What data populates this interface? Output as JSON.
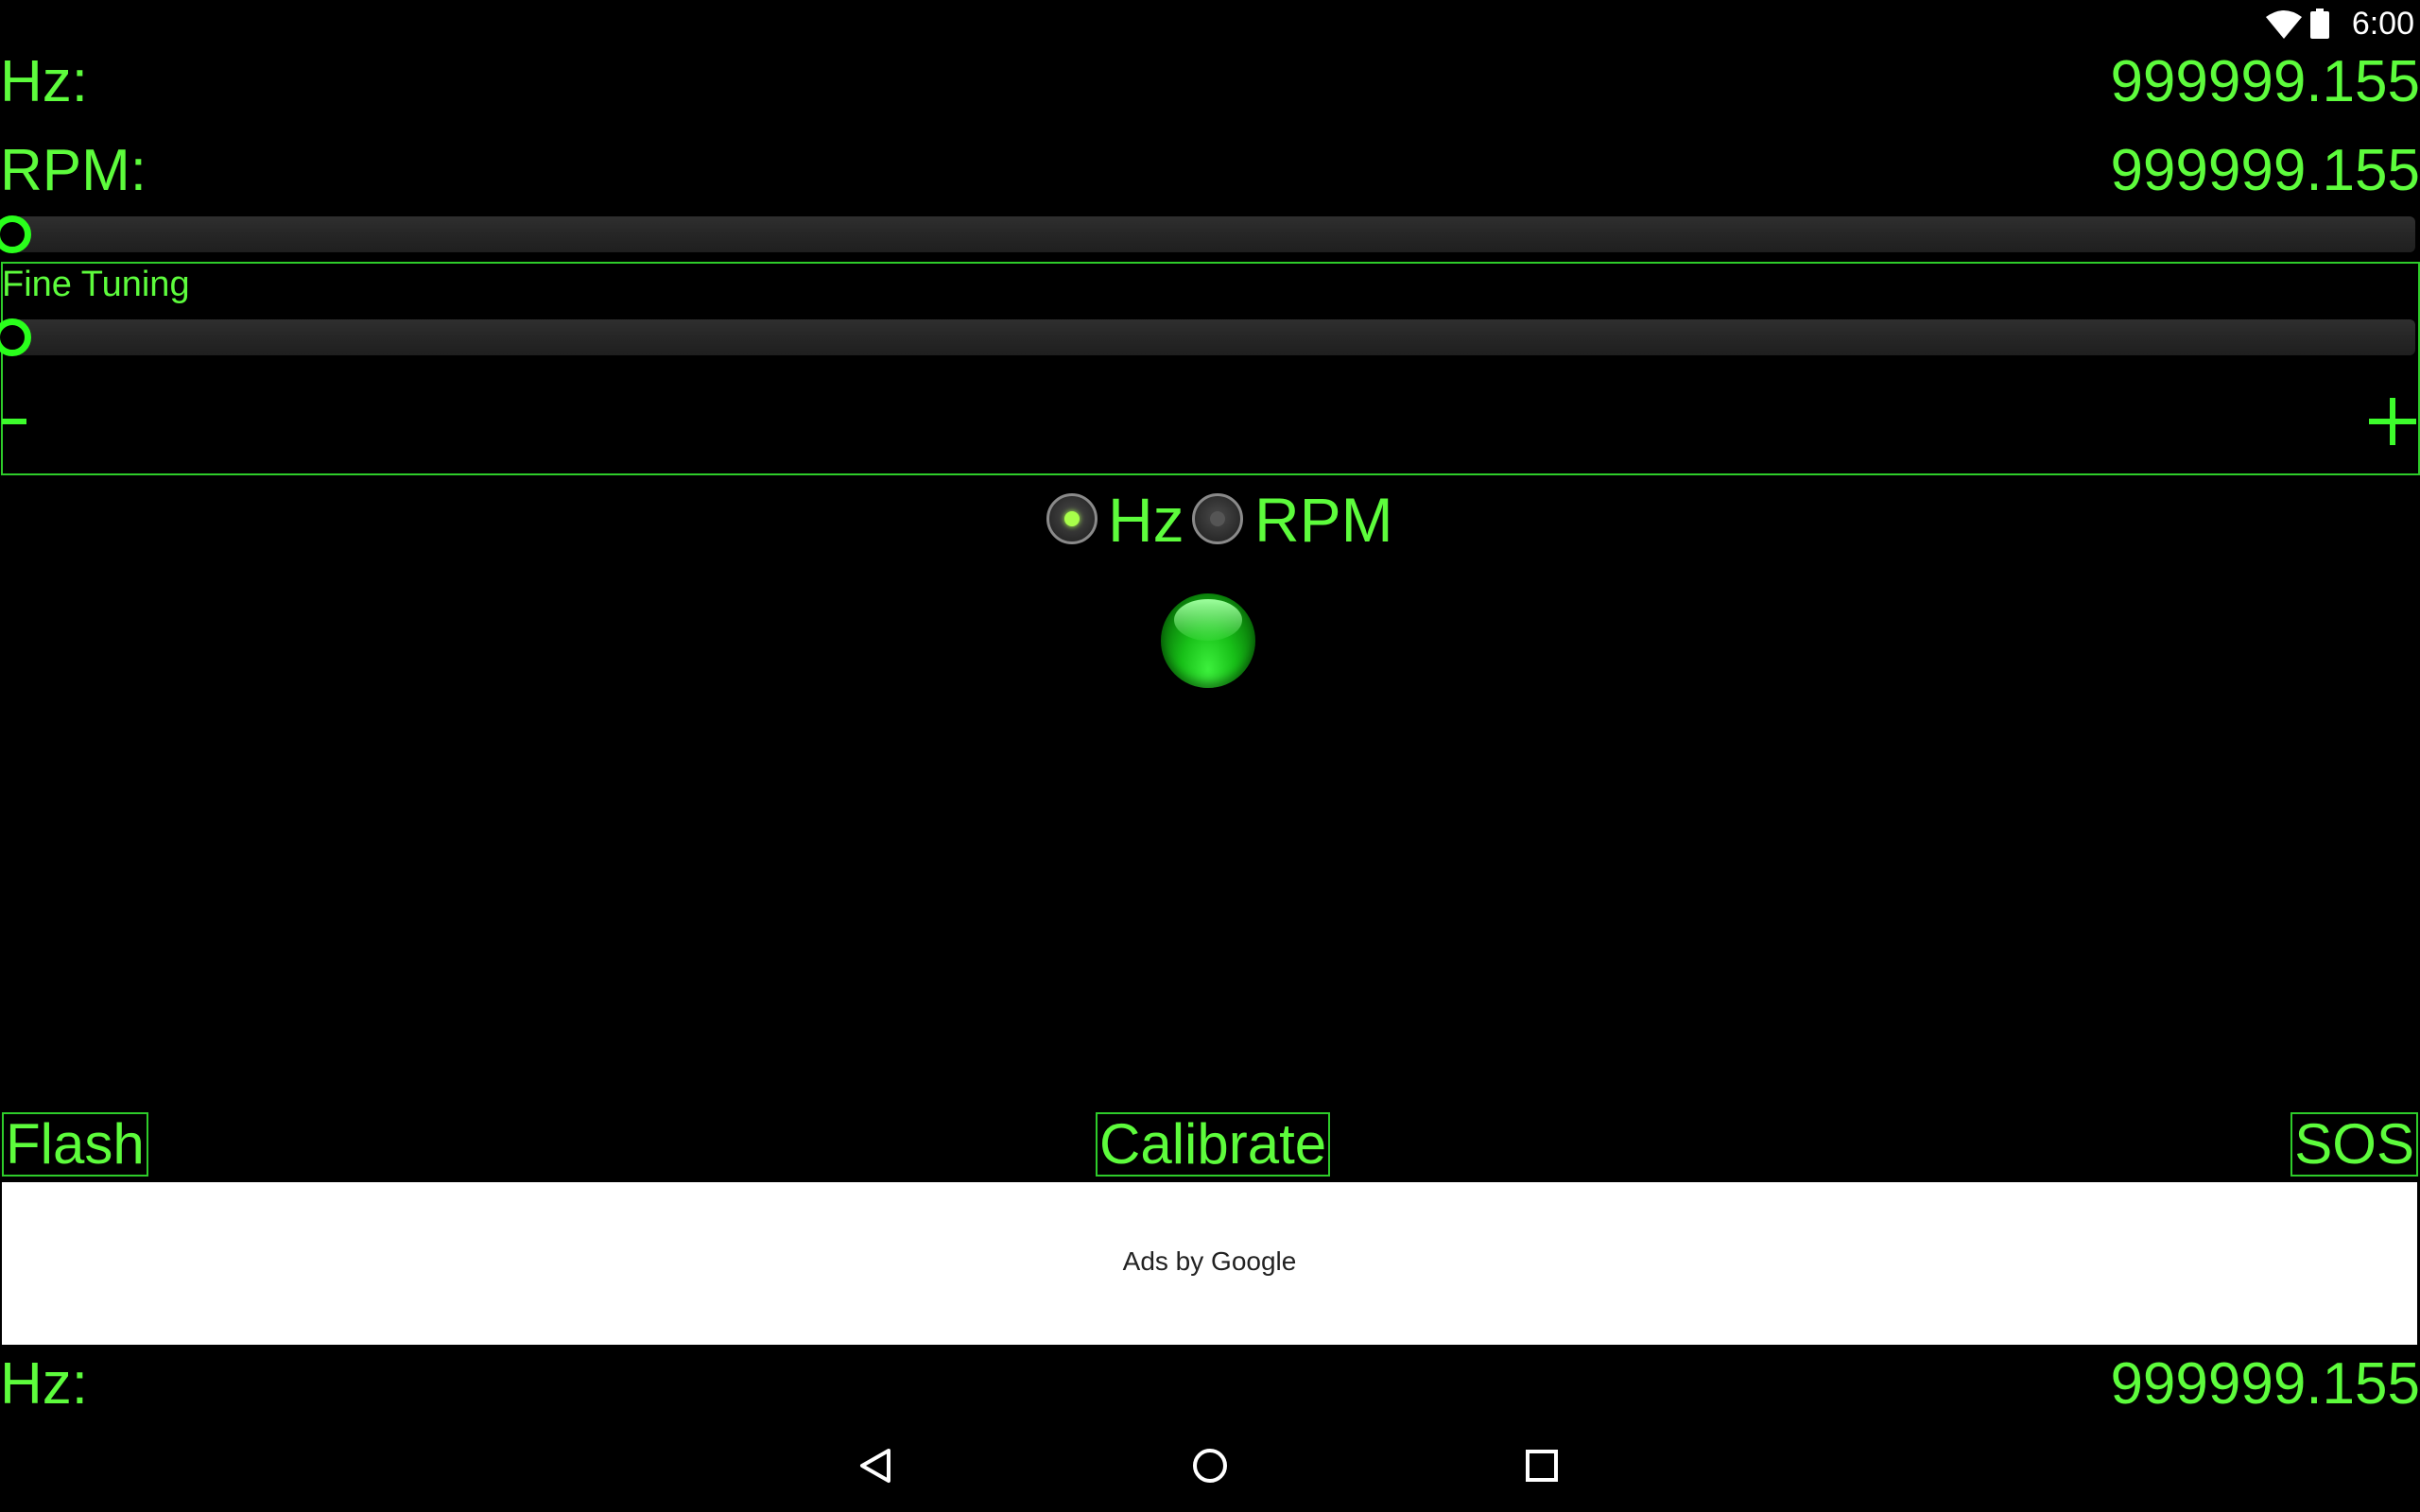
{
  "status_bar": {
    "time": "6:00",
    "icons": [
      "wifi-icon",
      "battery-icon"
    ]
  },
  "readouts": {
    "hz_label": "Hz:",
    "hz_value": "999999.155",
    "rpm_label": "RPM:",
    "rpm_value": "999999.155"
  },
  "sliders": {
    "main_value": 0,
    "fine_value": 0
  },
  "fine_tuning": {
    "label": "Fine Tuning",
    "minus_icon": "minus-icon",
    "plus_icon": "plus-icon"
  },
  "unit_selector": {
    "options": [
      {
        "label": "Hz",
        "checked": true
      },
      {
        "label": "RPM",
        "checked": false
      }
    ]
  },
  "indicator": {
    "icon": "green-led-icon",
    "color": "#22cc22"
  },
  "buttons": {
    "flash": "Flash",
    "calibrate": "Calibrate",
    "sos": "SOS"
  },
  "ad": {
    "text": "Ads by Google"
  },
  "footer_readout": {
    "label": "Hz:",
    "value": "999999.155"
  },
  "nav_bar": {
    "icons": [
      "back-icon",
      "home-icon",
      "recents-icon"
    ]
  },
  "colors": {
    "accent": "#5dfc3c",
    "border": "#2ecc2a",
    "background": "#000000"
  }
}
